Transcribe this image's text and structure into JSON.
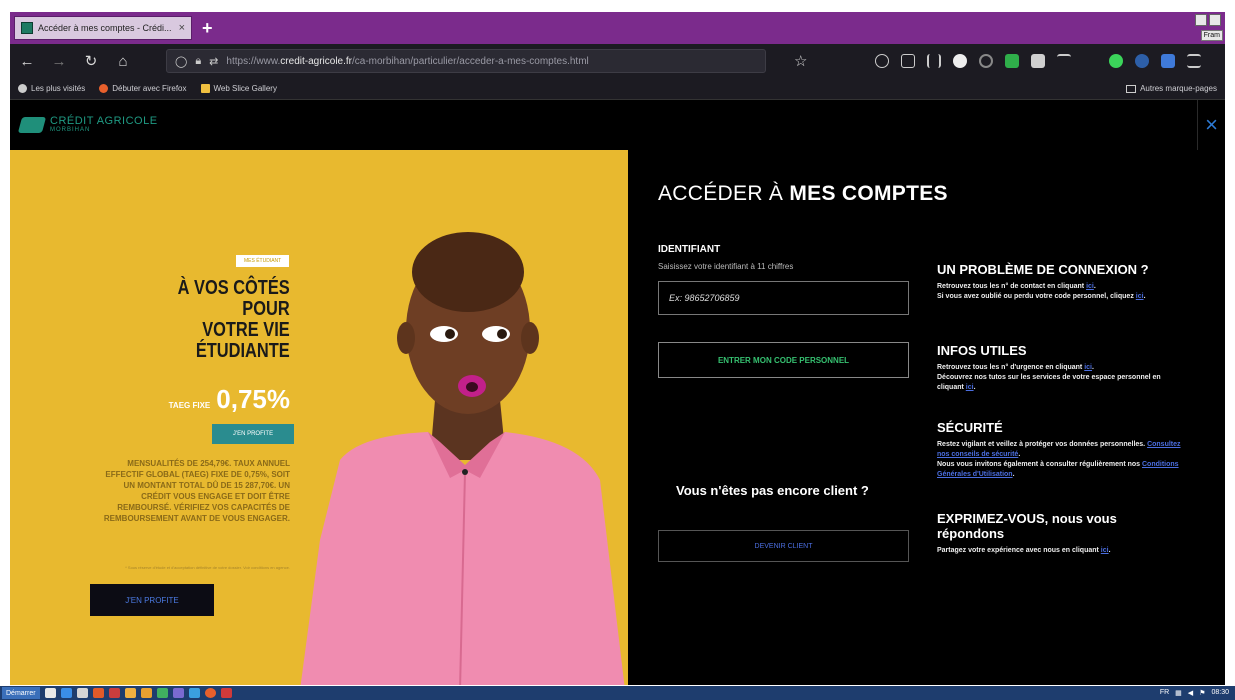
{
  "browser": {
    "tab_title": "Accéder à mes comptes - Crédi...",
    "tab_close": "×",
    "new_tab": "+",
    "window_label": "Fram",
    "url_prefix": "https://www.",
    "url_domain": "credit-agricole.fr",
    "url_path": "/ca-morbihan/particulier/acceder-a-mes-comptes.html",
    "bookmarks": [
      "Les plus visités",
      "Débuter avec Firefox",
      "Web Slice Gallery"
    ],
    "bookmarks_other": "Autres marque-pages"
  },
  "site": {
    "logo_name": "CRÉDIT AGRICOLE",
    "logo_region": "MORBIHAN",
    "close_symbol": "×"
  },
  "promo": {
    "badge": "MES ÉTUDIANT",
    "headline": [
      "À VOS CÔTÉS",
      "POUR",
      "VOTRE VIE",
      "ÉTUDIANTE"
    ],
    "rate_label": "TAEG FIXE",
    "rate_value": "0,75%",
    "cta_small": "J'EN PROFITE",
    "legal": "MENSUALITÉS DE 254,79€. TAUX ANNUEL EFFECTIF GLOBAL (TAEG) FIXE DE 0,75%, SOIT UN MONTANT TOTAL DÛ DE 15 287,70€. UN CRÉDIT VOUS ENGAGE ET DOIT ÊTRE REMBOURSÉ. VÉRIFIEZ VOS CAPACITÉS DE REMBOURSEMENT AVANT DE VOUS ENGAGER.",
    "fine_print": "* Sous réserve d'étude et d'acceptation définitive de votre dossier. Voir conditions en agence.",
    "cta_main": "J'EN PROFITE"
  },
  "login": {
    "title_light": "ACCÉDER À ",
    "title_bold": "MES COMPTES",
    "id_label": "IDENTIFIANT",
    "id_help": "Saisissez votre identifiant à 11 chiffres",
    "id_placeholder": "Ex: 98652706859",
    "btn_code": "ENTRER MON CODE PERSONNEL",
    "not_client": "Vous n'êtes pas encore client ?",
    "btn_devenir": "DEVENIR CLIENT"
  },
  "info": {
    "problem_title": "UN PROBLÈME DE CONNEXION ?",
    "problem_text1": "Retrouvez tous les n° de contact en cliquant ",
    "problem_text2": "Si vous avez oublié ou perdu votre code personnel, cliquez ",
    "link_ici": "ici",
    "infos_title": "INFOS UTILES",
    "infos_text1": "Retrouvez tous les n° d'urgence en cliquant ",
    "infos_text2": "Découvrez nos tutos sur les services de votre espace personnel en cliquant ",
    "secu_title": "SÉCURITÉ",
    "secu_text1": "Restez vigilant et veillez à protéger vos données personnelles. ",
    "secu_link1": "Consultez nos conseils de sécurité",
    "secu_text2": "Nous vous invitons également à consulter régulièrement nos ",
    "secu_link2": "Conditions Générales d'Utilisation",
    "express_title": "EXPRIMEZ-VOUS, nous vous répondons",
    "express_text": "Partagez votre expérience avec nous en cliquant "
  },
  "taskbar": {
    "start": "Démarrer",
    "lang": "FR",
    "time": "08:30"
  }
}
